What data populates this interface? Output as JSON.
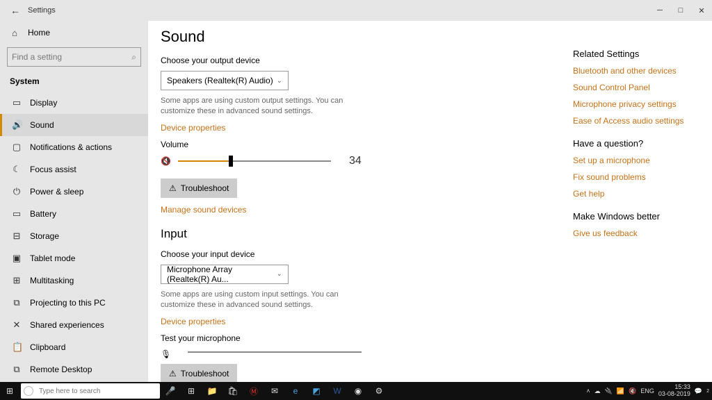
{
  "window": {
    "title": "Settings"
  },
  "sidebar": {
    "home": "Home",
    "search_placeholder": "Find a setting",
    "section": "System",
    "items": [
      {
        "label": "Display"
      },
      {
        "label": "Sound"
      },
      {
        "label": "Notifications & actions"
      },
      {
        "label": "Focus assist"
      },
      {
        "label": "Power & sleep"
      },
      {
        "label": "Battery"
      },
      {
        "label": "Storage"
      },
      {
        "label": "Tablet mode"
      },
      {
        "label": "Multitasking"
      },
      {
        "label": "Projecting to this PC"
      },
      {
        "label": "Shared experiences"
      },
      {
        "label": "Clipboard"
      },
      {
        "label": "Remote Desktop"
      }
    ]
  },
  "page": {
    "title": "Sound",
    "output_label": "Choose your output device",
    "output_device": "Speakers (Realtek(R) Audio)",
    "output_hint": "Some apps are using custom output settings. You can customize these in advanced sound settings.",
    "device_props": "Device properties",
    "volume_label": "Volume",
    "volume_value": "34",
    "troubleshoot": "Troubleshoot",
    "manage": "Manage sound devices",
    "input_heading": "Input",
    "input_label": "Choose your input device",
    "input_device": "Microphone Array (Realtek(R) Au...",
    "input_hint": "Some apps are using custom input settings. You can customize these in advanced sound settings.",
    "test_mic": "Test your microphone"
  },
  "right": {
    "related": "Related Settings",
    "r1": "Bluetooth and other devices",
    "r2": "Sound Control Panel",
    "r3": "Microphone privacy settings",
    "r4": "Ease of Access audio settings",
    "q": "Have a question?",
    "q1": "Set up a microphone",
    "q2": "Fix sound problems",
    "q3": "Get help",
    "better": "Make Windows better",
    "feedback": "Give us feedback"
  },
  "taskbar": {
    "search_placeholder": "Type here to search",
    "lang": "ENG",
    "time": "15:33",
    "date": "03-08-2019",
    "notif": "2"
  }
}
